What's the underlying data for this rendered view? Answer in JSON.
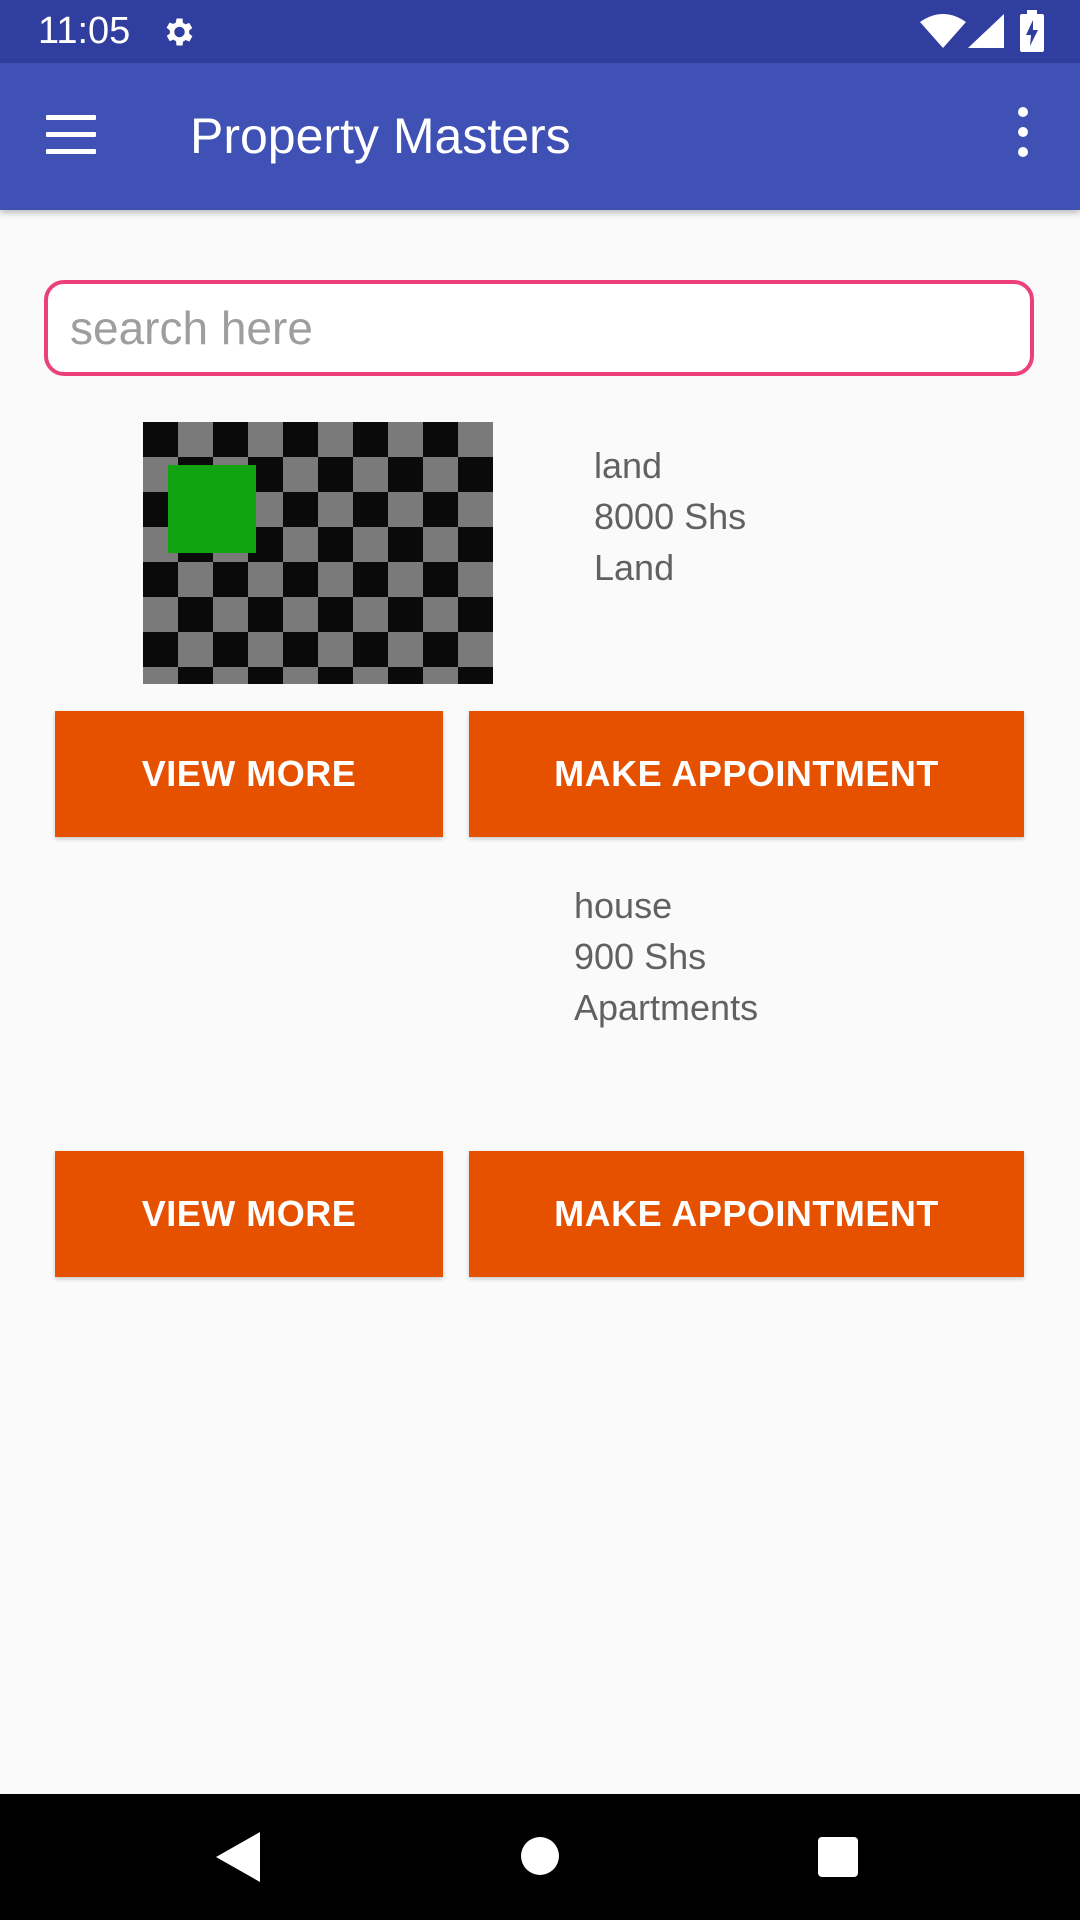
{
  "status_bar": {
    "time": "11:05",
    "icons": [
      "gear-icon",
      "wifi-icon",
      "signal-icon",
      "battery-icon"
    ]
  },
  "app_bar": {
    "title": "Property Masters",
    "left_icon": "menu-icon",
    "right_icon": "overflow-icon"
  },
  "search": {
    "placeholder": "search here",
    "value": ""
  },
  "listings": [
    {
      "name": "land",
      "price": "8000 Shs",
      "category": "Land",
      "has_image": true,
      "view_more_label": "VIEW MORE",
      "appointment_label": "MAKE APPOINTMENT"
    },
    {
      "name": "house",
      "price": "900 Shs",
      "category": "Apartments",
      "has_image": false,
      "view_more_label": "VIEW MORE",
      "appointment_label": "MAKE APPOINTMENT"
    }
  ],
  "nav_bar": {
    "icons": [
      "back-icon",
      "home-icon",
      "recents-icon"
    ]
  },
  "colors": {
    "status_bar": "#303f9f",
    "app_bar": "#3f51b5",
    "accent": "#ec407a",
    "button": "#e65100",
    "background": "#fafafa"
  }
}
